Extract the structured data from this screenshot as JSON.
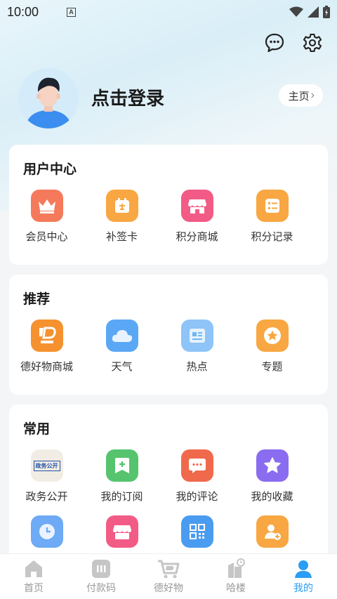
{
  "status": {
    "time": "10:00",
    "sim_letter": "A"
  },
  "header": {
    "login_text": "点击登录",
    "home_label": "主页",
    "home_chevron": "›"
  },
  "sections": {
    "user_center": {
      "title": "用户中心",
      "items": [
        {
          "label": "会员中心",
          "icon": "crown-icon",
          "color": "#f57a5b"
        },
        {
          "label": "补签卡",
          "icon": "calendar-makeup-icon",
          "color": "#f8a742"
        },
        {
          "label": "积分商城",
          "icon": "shop-icon",
          "color": "#f25b86"
        },
        {
          "label": "积分记录",
          "icon": "record-list-icon",
          "color": "#f8a742"
        }
      ]
    },
    "recommend": {
      "title": "推荐",
      "items": [
        {
          "label": "德好物商城",
          "icon": "dehaowu-logo-icon",
          "color": "#f5922f"
        },
        {
          "label": "天气",
          "icon": "cloud-icon",
          "color": "#5aa8f5"
        },
        {
          "label": "热点",
          "icon": "news-icon",
          "color": "#6eb7f4"
        },
        {
          "label": "专题",
          "icon": "star-badge-icon",
          "color": "#f8a742"
        }
      ]
    },
    "common": {
      "title": "常用",
      "items": [
        {
          "label": "政务公开",
          "icon": "gov-affairs-icon",
          "color": "#f2ede4",
          "badge_text": "政务公开"
        },
        {
          "label": "我的订阅",
          "icon": "bookmark-add-icon",
          "color": "#56c46e"
        },
        {
          "label": "我的评论",
          "icon": "comment-icon",
          "color": "#f0694c"
        },
        {
          "label": "我的收藏",
          "icon": "star-icon",
          "color": "#8a6cf0"
        }
      ],
      "items_row2": [
        {
          "icon": "clock-icon",
          "color": "#6eaaf5"
        },
        {
          "icon": "store-icon",
          "color": "#f25b86"
        },
        {
          "icon": "qr-code-icon",
          "color": "#4a9cf0"
        },
        {
          "icon": "user-add-icon",
          "color": "#f8a742"
        }
      ]
    }
  },
  "bottom_nav": [
    {
      "label": "首页",
      "icon": "home-icon",
      "active": false
    },
    {
      "label": "付款码",
      "icon": "pay-code-icon",
      "active": false
    },
    {
      "label": "德好物",
      "icon": "cart-icon",
      "active": false
    },
    {
      "label": "哈楼",
      "icon": "building-icon",
      "active": false
    },
    {
      "label": "我的",
      "icon": "profile-icon",
      "active": true
    }
  ],
  "colors": {
    "accent": "#2a9df4",
    "inactive": "#9a9a9a"
  }
}
